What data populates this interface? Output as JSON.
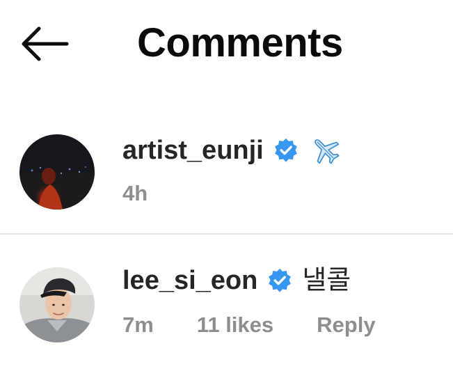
{
  "header": {
    "title": "Comments",
    "back_icon": "arrow-left-icon"
  },
  "comments": [
    {
      "username": "artist_eunji",
      "verified": true,
      "text": "",
      "emoji_icon": "airplane-icon",
      "time": "4h"
    },
    {
      "username": "lee_si_eon",
      "verified": true,
      "text": "낼콜",
      "time": "7m",
      "likes": "11 likes",
      "reply_label": "Reply"
    }
  ],
  "colors": {
    "verified_badge": "#3797f0",
    "secondary_text": "#8e8e8e",
    "primary_text": "#262626",
    "divider": "#e3e3e3"
  }
}
